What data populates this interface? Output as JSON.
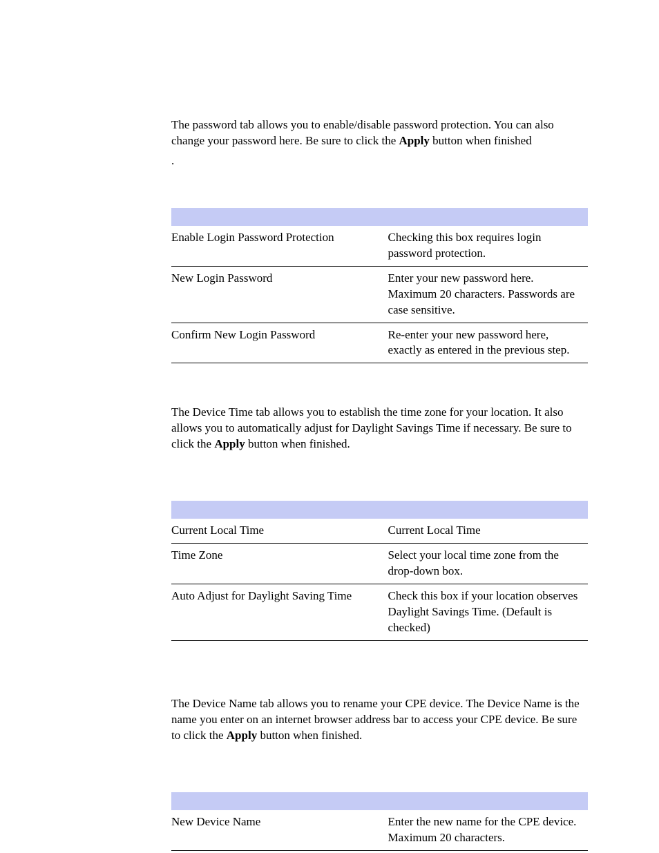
{
  "section1": {
    "intro_pre": "The password tab allows you to enable/disable password protection. You can also change your password here. Be sure to click the ",
    "intro_bold": "Apply",
    "intro_post": " button when finished",
    "dot": ".",
    "rows": [
      {
        "field": "Enable Login Password Protection",
        "desc": "Checking this box requires login password protection."
      },
      {
        "field": "New Login Password",
        "desc": "Enter your new password here. Maximum 20 characters. Passwords are case sensitive."
      },
      {
        "field": "Confirm New Login Password",
        "desc": "Re-enter your new password here, exactly as entered in the previous step."
      }
    ]
  },
  "section2": {
    "intro_pre": "The Device Time tab allows you to establish the time zone for your location. It also allows you to automatically adjust for Daylight Savings Time if necessary. Be sure to click the ",
    "intro_bold": "Apply",
    "intro_post": " button when finished.",
    "rows": [
      {
        "field": "Current Local Time",
        "desc": "Current Local Time"
      },
      {
        "field": "Time Zone",
        "desc": "Select your local time zone from the drop-down box."
      },
      {
        "field": "Auto Adjust for Daylight Saving Time",
        "desc": "Check this box if your location observes Daylight Savings Time. (Default is checked)"
      }
    ]
  },
  "section3": {
    "intro_pre": "The Device Name tab allows you to rename your CPE device. The Device Name is the name you enter on an internet browser address bar to access your CPE device. Be sure to click the ",
    "intro_bold": "Apply",
    "intro_post": " button when finished.",
    "rows": [
      {
        "field": "New Device Name",
        "desc": "Enter the new name for the CPE device. Maximum 20 characters."
      }
    ]
  }
}
